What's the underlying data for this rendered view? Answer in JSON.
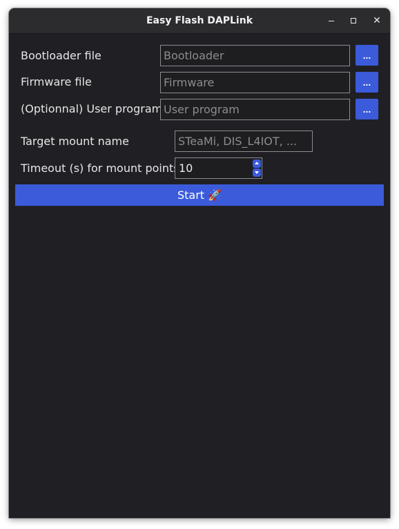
{
  "window": {
    "title": "Easy Flash DAPLink",
    "minimize_glyph": "",
    "maximize_glyph": "",
    "close_glyph": "✕"
  },
  "form": {
    "bootloader": {
      "label": "Bootloader file",
      "placeholder": "Bootloader",
      "browse_label": "..."
    },
    "firmware": {
      "label": "Firmware file",
      "placeholder": "Firmware",
      "browse_label": "..."
    },
    "user_program": {
      "label": "(Optionnal) User program",
      "placeholder": "User program",
      "browse_label": "..."
    },
    "target_mount": {
      "label": "Target mount name",
      "placeholder": "STeaMi, DIS_L4IOT, ..."
    },
    "timeout": {
      "label": "Timeout (s) for mount points",
      "value": "10"
    },
    "start_label": "Start 🚀"
  },
  "colors": {
    "accent": "#3b5bdb",
    "window_bg": "#202024",
    "titlebar_bg": "#2c2c2f",
    "field_border": "#8d8d91"
  }
}
